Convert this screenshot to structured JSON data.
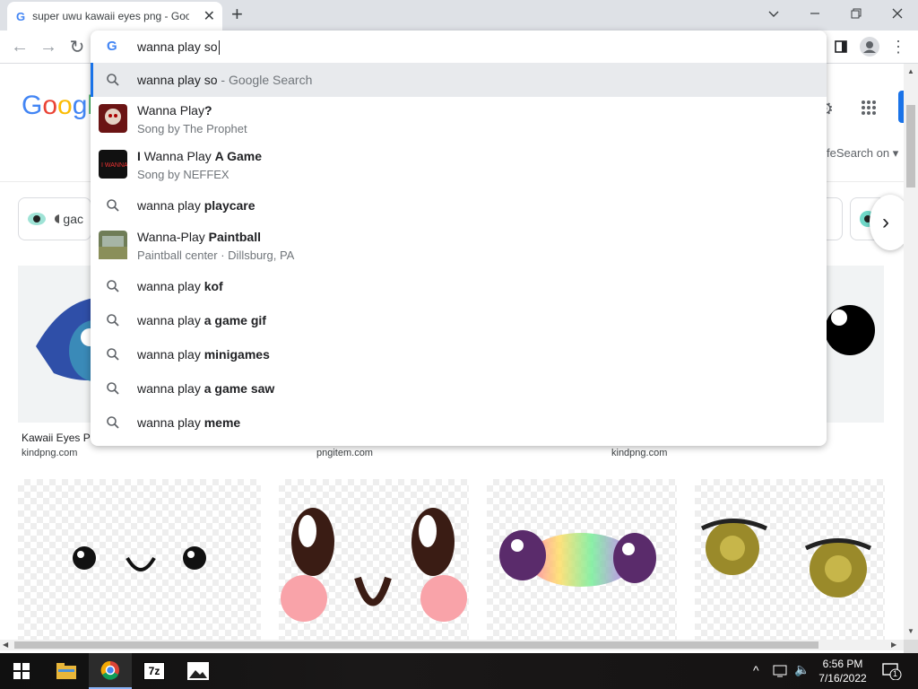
{
  "browser": {
    "tab_title": "super uwu kawaii eyes png - Goo",
    "new_tab_label": "+",
    "window_controls": [
      "minimize",
      "restore",
      "close"
    ]
  },
  "omnibox": {
    "value": "wanna play so",
    "suggestions": [
      {
        "type": "search",
        "text": "wanna play so",
        "suffix": " - Google Search",
        "bold": ""
      },
      {
        "type": "entity",
        "pre": "",
        "normal": "Wanna Play",
        "bold": "?",
        "sub": "Song by The Prophet"
      },
      {
        "type": "entity",
        "pre": "I",
        "normal": " Wanna Play ",
        "bold": "A Game",
        "sub": "Song by NEFFEX"
      },
      {
        "type": "search",
        "text": "wanna play ",
        "bold": "playcare"
      },
      {
        "type": "entity",
        "pre": "",
        "normal": "Wanna-Play ",
        "bold": "Paintball",
        "sub": "Paintball center · Dillsburg, PA"
      },
      {
        "type": "search",
        "text": "wanna play ",
        "bold": "kof"
      },
      {
        "type": "search",
        "text": "wanna play ",
        "bold": "a game gif"
      },
      {
        "type": "search",
        "text": "wanna play ",
        "bold": "minigames"
      },
      {
        "type": "search",
        "text": "wanna play ",
        "bold": "a game saw"
      },
      {
        "type": "search",
        "text": "wanna play ",
        "bold": "meme"
      }
    ]
  },
  "page": {
    "logo_text": "Googl",
    "safesearch": "feSearch on",
    "chip_partial": "gac",
    "results": [
      {
        "title": "Kawaii Eyes Pl",
        "source": "kindpng.com"
      },
      {
        "title": "",
        "source": "pngitem.com"
      },
      {
        "title": "",
        "source": "kindpng.com"
      }
    ]
  },
  "taskbar": {
    "time": "6:56 PM",
    "date": "7/16/2022",
    "notification_count": "1"
  }
}
